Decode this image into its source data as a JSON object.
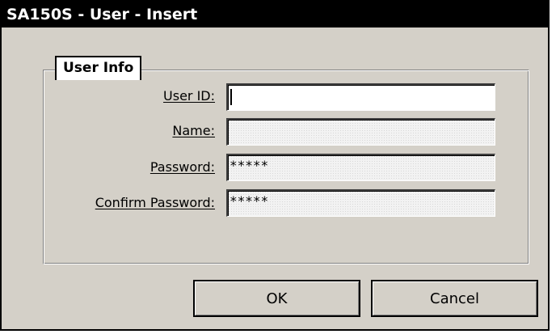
{
  "window": {
    "title": "SA150S - User - Insert"
  },
  "group": {
    "title": "User Info"
  },
  "fields": {
    "user_id": {
      "label": "User ID:",
      "value": ""
    },
    "name": {
      "label": "Name:",
      "value": ""
    },
    "password": {
      "label": "Password:",
      "value": "*****"
    },
    "confirm_password": {
      "label": "Confirm Password:",
      "value": "*****"
    }
  },
  "buttons": {
    "ok_label": "OK",
    "cancel_label": "Cancel"
  },
  "colors": {
    "titlebar": "#000000",
    "face": "#d4d0c8",
    "input_active": "#ffffff",
    "input_disabled": "#f2f2f2"
  }
}
